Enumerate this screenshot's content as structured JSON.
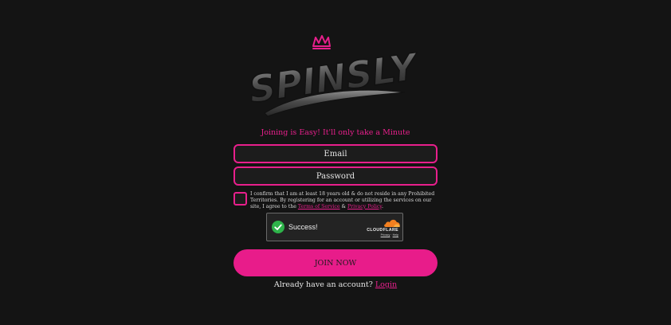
{
  "brand": {
    "logo_text": "SPINSLY",
    "logo_icon": "crown-icon",
    "accent_color": "#e81f8c"
  },
  "form": {
    "tagline": "Joining is Easy! It'll only take a Minute",
    "email_placeholder": "Email",
    "password_placeholder": "Password",
    "consent_prefix": "I confirm that I am at least 18 years old & do not reside in any Prohibited Territories. By registering for an account or utilizing the services on our site, I agree to the ",
    "terms_label": "Terms of Service",
    "consent_and": " & ",
    "privacy_label": "Privacy Policy",
    "consent_suffix": ".",
    "join_label": "JOIN NOW",
    "signin_prompt": "Already have an account? ",
    "login_label": "Login"
  },
  "captcha": {
    "status": "Success!",
    "brand": "CLOUDFLARE",
    "privacy_label": "Privacy",
    "separator": "·",
    "help_label": "Help",
    "status_color": "#2eb34a"
  }
}
